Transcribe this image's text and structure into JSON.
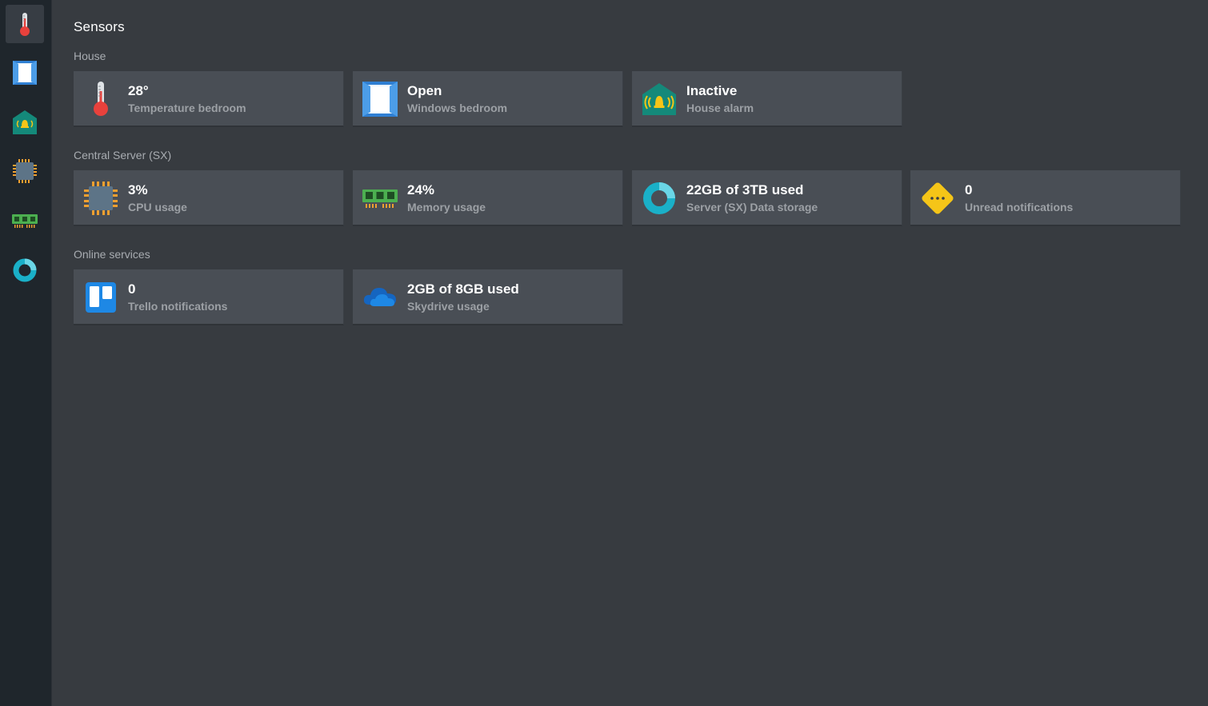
{
  "colors": {
    "background": "#373b40",
    "sidebar": "#1f262c",
    "card": "#494e55",
    "value_text": "#ffffff",
    "label_text": "#9ca0a5",
    "section_text": "#a8acb1"
  },
  "sidebar": {
    "items": [
      {
        "icon": "thermometer-icon",
        "active": true
      },
      {
        "icon": "window-icon",
        "active": false
      },
      {
        "icon": "house-alarm-icon",
        "active": false
      },
      {
        "icon": "cpu-chip-icon",
        "active": false
      },
      {
        "icon": "memory-ram-icon",
        "active": false
      },
      {
        "icon": "donut-storage-icon",
        "active": false
      }
    ]
  },
  "page": {
    "title": "Sensors"
  },
  "sections": [
    {
      "title": "House",
      "cards": [
        {
          "icon": "thermometer-icon",
          "value": "28°",
          "label": "Temperature bedroom"
        },
        {
          "icon": "window-icon",
          "value": "Open",
          "label": "Windows bedroom"
        },
        {
          "icon": "house-alarm-icon",
          "value": "Inactive",
          "label": "House alarm"
        }
      ]
    },
    {
      "title": "Central Server (SX)",
      "cards": [
        {
          "icon": "cpu-chip-icon",
          "value": "3%",
          "label": "CPU usage"
        },
        {
          "icon": "memory-ram-icon",
          "value": "24%",
          "label": "Memory usage"
        },
        {
          "icon": "donut-storage-icon",
          "value": "22GB of 3TB used",
          "label": "Server (SX) Data storage"
        },
        {
          "icon": "warning-diamond-icon",
          "value": "0",
          "label": "Unread notifications"
        }
      ]
    },
    {
      "title": "Online services",
      "cards": [
        {
          "icon": "trello-icon",
          "value": "0",
          "label": "Trello notifications"
        },
        {
          "icon": "cloud-icon",
          "value": "2GB of 8GB used",
          "label": "Skydrive usage"
        }
      ]
    }
  ]
}
